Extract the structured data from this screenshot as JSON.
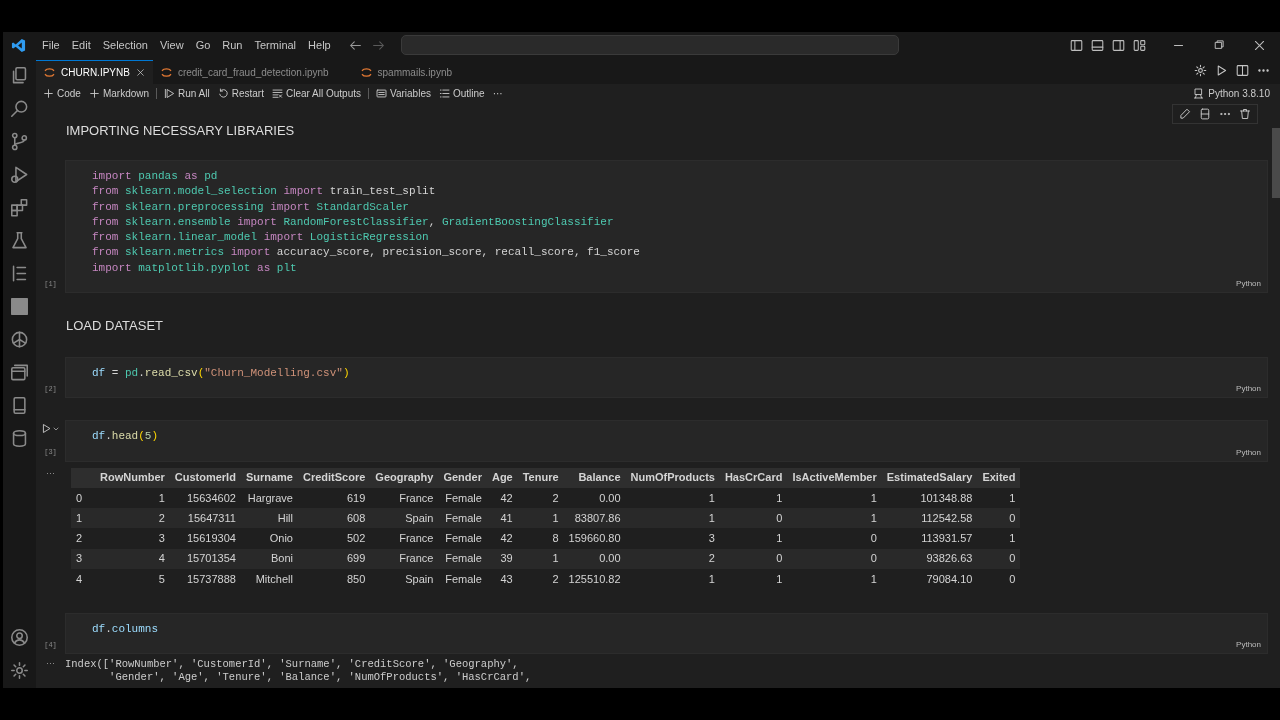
{
  "menu": [
    "File",
    "Edit",
    "Selection",
    "View",
    "Go",
    "Run",
    "Terminal",
    "Help"
  ],
  "tabs": [
    {
      "label": "CHURN.IPYNB",
      "selected": true
    },
    {
      "label": "credit_card_fraud_detection.ipynb",
      "selected": false
    },
    {
      "label": "spammails.ipynb",
      "selected": false
    }
  ],
  "toolbar": [
    "Code",
    "Markdown",
    "Run All",
    "Restart",
    "Clear All Outputs",
    "Variables",
    "Outline",
    "···"
  ],
  "kernel": "Python 3.8.10",
  "cells": [
    {
      "kind": "markdown",
      "text": "IMPORTING NECESSARY LIBRARIES"
    },
    {
      "kind": "code",
      "count": "[1]",
      "language": "Python",
      "hovered": false,
      "lines": [
        [
          {
            "text": "import",
            "kind": "kw"
          },
          {
            "text": " pandas",
            "kind": "mod"
          },
          {
            "text": " as",
            "kind": "kw"
          },
          {
            "text": " pd",
            "kind": "mod"
          }
        ],
        [
          {
            "text": "from",
            "kind": "kw"
          },
          {
            "text": " sklearn.model_selection",
            "kind": "mod"
          },
          {
            "text": " import",
            "kind": "kw"
          },
          {
            "text": " train_test_split",
            "kind": "plain"
          }
        ],
        [
          {
            "text": "from",
            "kind": "kw"
          },
          {
            "text": " sklearn.preprocessing",
            "kind": "mod"
          },
          {
            "text": " import",
            "kind": "kw"
          },
          {
            "text": " StandardScaler",
            "kind": "cls"
          }
        ],
        [
          {
            "text": "from",
            "kind": "kw"
          },
          {
            "text": " sklearn.ensemble",
            "kind": "mod"
          },
          {
            "text": " import",
            "kind": "kw"
          },
          {
            "text": " RandomForestClassifier",
            "kind": "cls"
          },
          {
            "text": ",",
            "kind": "plain"
          },
          {
            "text": " GradientBoostingClassifier",
            "kind": "cls"
          }
        ],
        [
          {
            "text": "from",
            "kind": "kw"
          },
          {
            "text": " sklearn.linear_model",
            "kind": "mod"
          },
          {
            "text": " import",
            "kind": "kw"
          },
          {
            "text": " LogisticRegression",
            "kind": "cls"
          }
        ],
        [
          {
            "text": "from",
            "kind": "kw"
          },
          {
            "text": " sklearn.metrics",
            "kind": "mod"
          },
          {
            "text": " import",
            "kind": "kw"
          },
          {
            "text": " accuracy_score, precision_score, recall_score, f1_score",
            "kind": "plain"
          }
        ],
        [
          {
            "text": "import",
            "kind": "kw"
          },
          {
            "text": " matplotlib.pyplot",
            "kind": "mod"
          },
          {
            "text": " as",
            "kind": "kw"
          },
          {
            "text": " plt",
            "kind": "mod"
          }
        ]
      ]
    },
    {
      "kind": "markdown",
      "text": "LOAD DATASET"
    },
    {
      "kind": "code",
      "count": "[2]",
      "language": "Python",
      "hovered": false,
      "lines": [
        [
          {
            "text": "df",
            "kind": "var"
          },
          {
            "text": " = ",
            "kind": "plain"
          },
          {
            "text": "pd",
            "kind": "mod"
          },
          {
            "text": ".",
            "kind": "plain"
          },
          {
            "text": "read_csv",
            "kind": "fn"
          },
          {
            "text": "(",
            "kind": "brace"
          },
          {
            "text": "\"Churn_Modelling.csv\"",
            "kind": "str"
          },
          {
            "text": ")",
            "kind": "brace"
          }
        ]
      ]
    },
    {
      "kind": "code",
      "count": "[3]",
      "language": "Python",
      "hovered": true,
      "lines": [
        [
          {
            "text": "df",
            "kind": "var"
          },
          {
            "text": ".",
            "kind": "plain"
          },
          {
            "text": "head",
            "kind": "fn"
          },
          {
            "text": "(",
            "kind": "brace"
          },
          {
            "text": "5",
            "kind": "num"
          },
          {
            "text": ")",
            "kind": "brace"
          }
        ]
      ],
      "output": {
        "kind": "table",
        "more": "···",
        "columns": [
          "RowNumber",
          "CustomerId",
          "Surname",
          "CreditScore",
          "Geography",
          "Gender",
          "Age",
          "Tenure",
          "Balance",
          "NumOfProducts",
          "HasCrCard",
          "IsActiveMember",
          "EstimatedSalary",
          "Exited"
        ],
        "rows": [
          {
            "index": "0",
            "cells": [
              "1",
              "15634602",
              "Hargrave",
              "619",
              "France",
              "Female",
              "42",
              "2",
              "0.00",
              "1",
              "1",
              "1",
              "101348.88",
              "1"
            ]
          },
          {
            "index": "1",
            "cells": [
              "2",
              "15647311",
              "Hill",
              "608",
              "Spain",
              "Female",
              "41",
              "1",
              "83807.86",
              "1",
              "0",
              "1",
              "112542.58",
              "0"
            ]
          },
          {
            "index": "2",
            "cells": [
              "3",
              "15619304",
              "Onio",
              "502",
              "France",
              "Female",
              "42",
              "8",
              "159660.80",
              "3",
              "1",
              "0",
              "113931.57",
              "1"
            ]
          },
          {
            "index": "3",
            "cells": [
              "4",
              "15701354",
              "Boni",
              "699",
              "France",
              "Female",
              "39",
              "1",
              "0.00",
              "2",
              "0",
              "0",
              "93826.63",
              "0"
            ]
          },
          {
            "index": "4",
            "cells": [
              "5",
              "15737888",
              "Mitchell",
              "850",
              "Spain",
              "Female",
              "43",
              "2",
              "125510.82",
              "1",
              "1",
              "1",
              "79084.10",
              "0"
            ]
          }
        ]
      }
    },
    {
      "kind": "code",
      "count": "[4]",
      "language": "Python",
      "hovered": false,
      "lines": [
        [
          {
            "text": "df",
            "kind": "var"
          },
          {
            "text": ".",
            "kind": "plain"
          },
          {
            "text": "columns",
            "kind": "var"
          }
        ]
      ],
      "output": {
        "kind": "text",
        "more": "···",
        "lines": [
          "Index(['RowNumber', 'CustomerId', 'Surname', 'CreditScore', 'Geography',",
          "       'Gender', 'Age', 'Tenure', 'Balance', 'NumOfProducts', 'HasCrCard',"
        ]
      }
    }
  ]
}
